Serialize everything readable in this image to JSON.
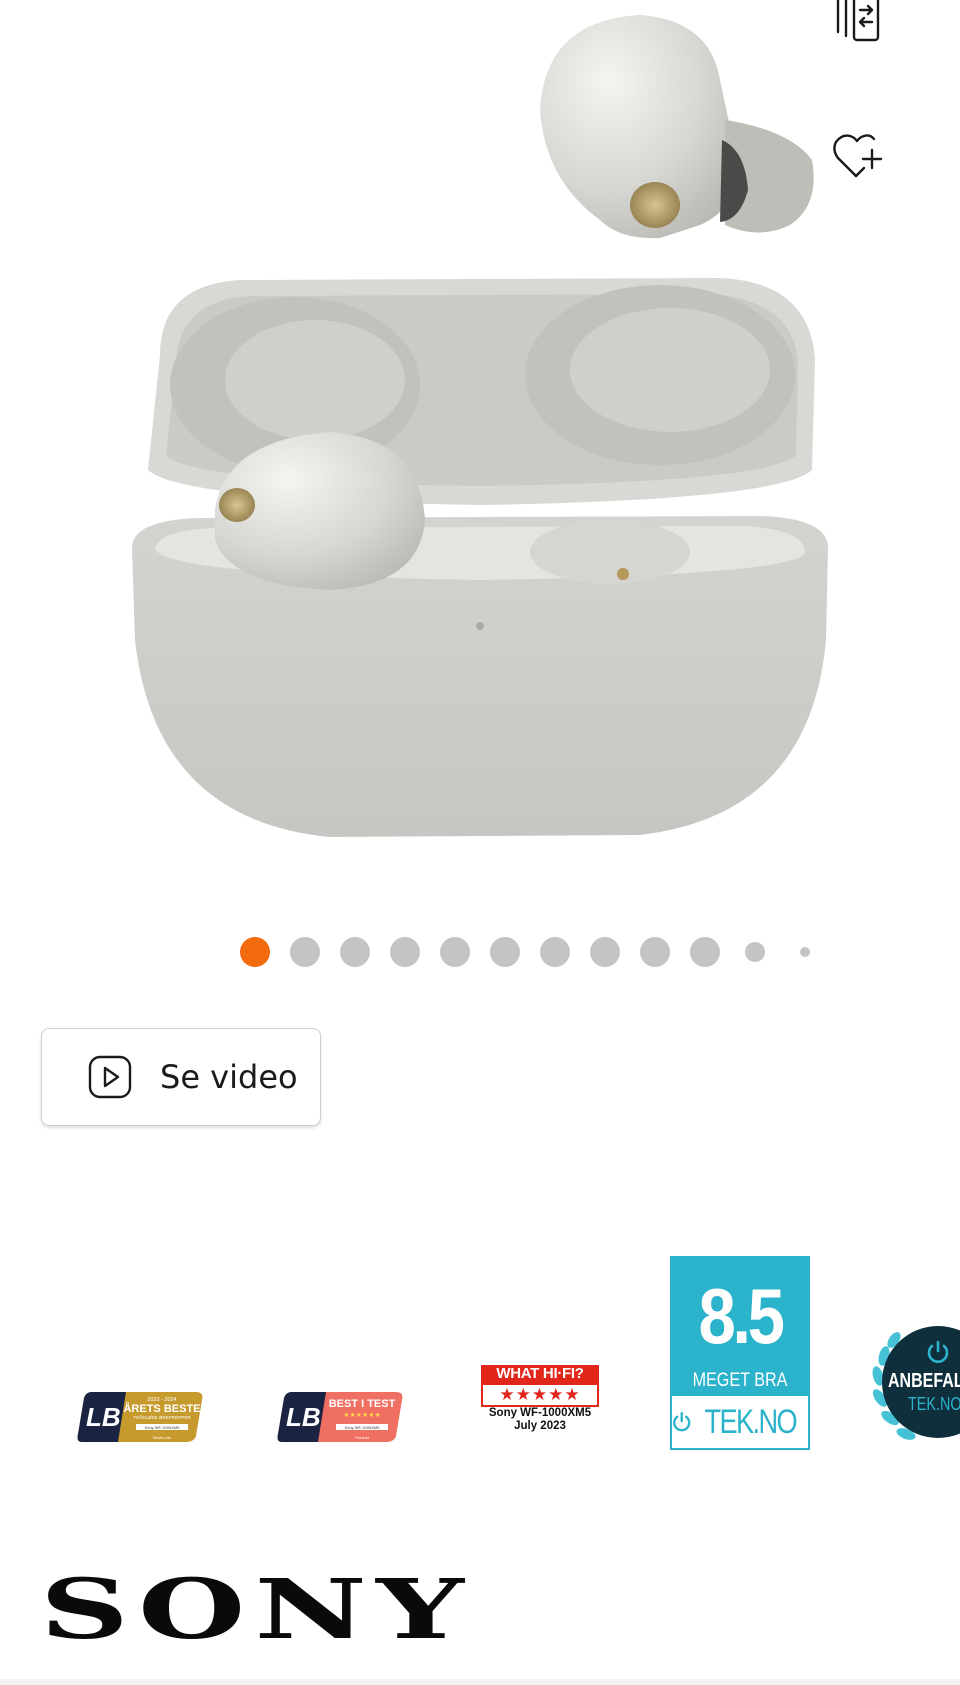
{
  "actions": {
    "compare_icon": "compare-icon",
    "wishlist_icon": "heart-plus-icon"
  },
  "product": {
    "image_icon": "wireless-earbuds-charging-case-image",
    "case_color": "#cfcfcb"
  },
  "carousel": {
    "total_dots": 12,
    "active_index": 0,
    "active_color": "#f26b0f",
    "inactive_color": "#c4c4c4"
  },
  "video_button": {
    "label": "Se video",
    "icon": "play-icon"
  },
  "badges": {
    "lb1": {
      "lines": [
        "2023 - 2024",
        "ÅRETS BESTE",
        "TRÅDLØSE ØREPROPPER",
        "Sony WF-1000XM5",
        "Beste pris"
      ]
    },
    "lb2": {
      "lines": [
        "BEST I TEST",
        "★★★★★★",
        "Sony WF-1000XM5",
        "Produkt"
      ]
    },
    "whathifi": {
      "title": "WHAT HI·FI?",
      "stars": "★★★★★",
      "product": "Sony WF-1000XM5",
      "date": "July 2023"
    },
    "tekno": {
      "score": "8.5",
      "verdict": "MEGET BRA",
      "brand": "TEK.NO"
    },
    "anbefalt": {
      "title": "ANBEFALT",
      "sub": "TEK.NO"
    }
  },
  "brand": {
    "logo_text": "SONY"
  }
}
